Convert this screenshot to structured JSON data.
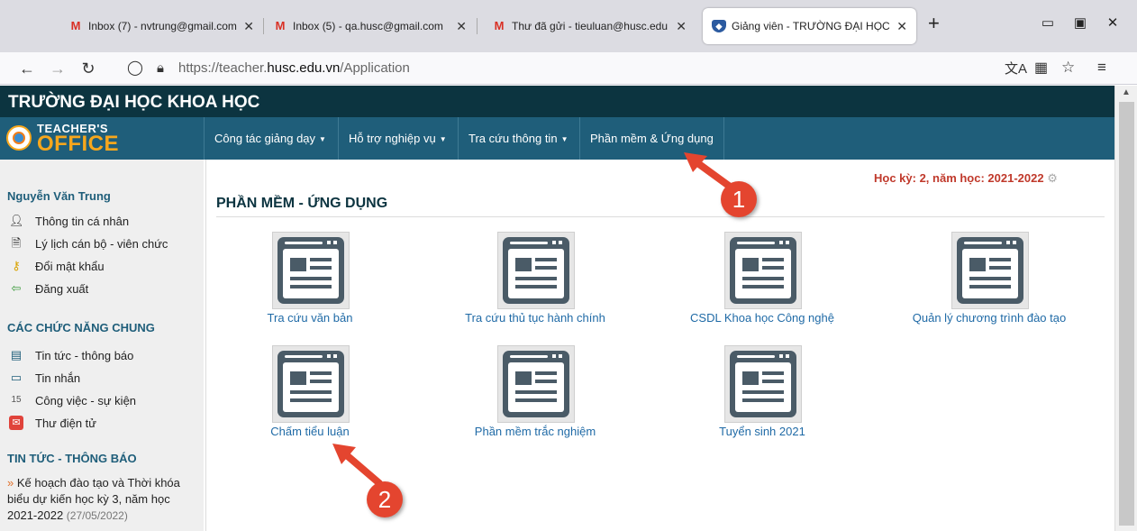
{
  "browser": {
    "tabs": [
      {
        "title": "Inbox (7) - nvtrung@gmail.com",
        "icon": "gmail-icon"
      },
      {
        "title": "Inbox (5) - qa.husc@gmail.com",
        "icon": "gmail-icon"
      },
      {
        "title": "Thư đã gửi - tieuluan@husc.edu",
        "icon": "gmail-icon"
      },
      {
        "title": "Giảng viên - TRƯỜNG ĐẠI HỌC",
        "icon": "shield-icon",
        "active": true
      }
    ],
    "url_prefix": "https://teacher.",
    "url_domain": "husc.edu.vn",
    "url_path": "/Application"
  },
  "site": {
    "school_name": "TRƯỜNG ĐẠI HỌC KHOA HỌC",
    "logo_line1": "TEACHER'S",
    "logo_line2": "OFFICE",
    "menu": [
      {
        "label": "Công tác giảng dạy",
        "has_caret": true
      },
      {
        "label": "Hỗ trợ nghiệp vụ",
        "has_caret": true
      },
      {
        "label": "Tra cứu thông tin",
        "has_caret": true
      },
      {
        "label": "Phần mềm & Ứng dụng",
        "has_caret": false
      }
    ],
    "semester": "Học kỳ: 2, năm học: 2021-2022"
  },
  "sidebar": {
    "user_name": "Nguyễn Văn Trung",
    "personal_items": [
      "Thông tin cá nhân",
      "Lý lịch cán bộ - viên chức",
      "Đổi mật khẩu",
      "Đăng xuất"
    ],
    "common_heading": "CÁC CHỨC NĂNG CHUNG",
    "common_items": [
      "Tin tức - thông báo",
      "Tin nhắn",
      "Công việc - sự kiện",
      "Thư điện tử"
    ],
    "news_heading": "TIN TỨC - THÔNG BÁO",
    "news_marker": "»",
    "news_item": "Kế hoạch đào tạo và Thời khóa biểu dự kiến học kỳ 3, năm học 2021-2022",
    "news_date": "(27/05/2022)"
  },
  "main": {
    "title": "PHẦN MỀM - ỨNG DỤNG",
    "apps": [
      {
        "label": "Tra cứu văn bản"
      },
      {
        "label": "Tra cứu thủ tục hành chính"
      },
      {
        "label": "CSDL Khoa học Công nghệ"
      },
      {
        "label": "Quản lý chương trình đào tạo"
      },
      {
        "label": "Chấm tiểu luận"
      },
      {
        "label": "Phần mềm trắc nghiệm"
      },
      {
        "label": "Tuyển sinh 2021"
      }
    ]
  },
  "annotations": {
    "step1": "1",
    "step2": "2",
    "color": "#e4452f"
  }
}
